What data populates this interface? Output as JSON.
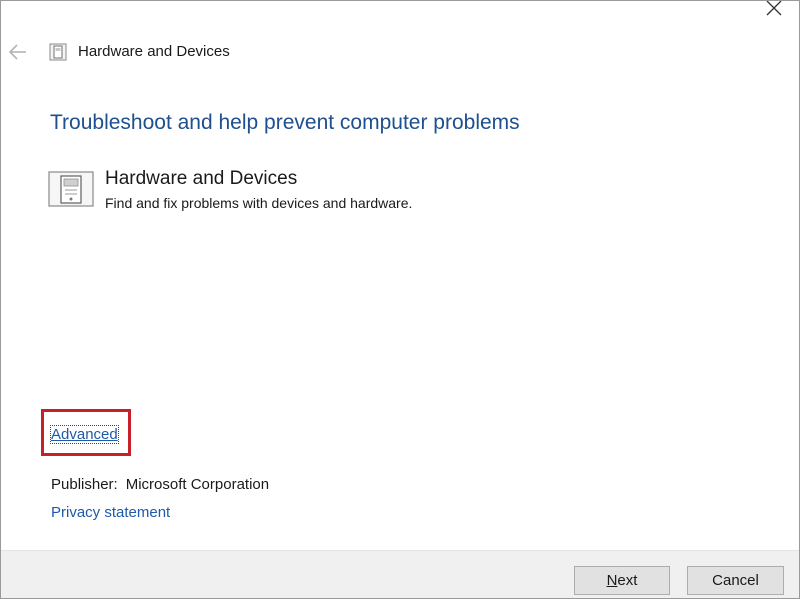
{
  "window": {
    "title": "Hardware and Devices"
  },
  "main": {
    "heading": "Troubleshoot and help prevent computer problems",
    "troubleshooter": {
      "title": "Hardware and Devices",
      "description": "Find and fix problems with devices and hardware."
    },
    "advanced_link": "Advanced",
    "publisher_label": "Publisher:",
    "publisher_value": "Microsoft Corporation",
    "privacy_link": "Privacy statement"
  },
  "footer": {
    "next_accel": "N",
    "next_rest": "ext",
    "cancel_label": "Cancel"
  },
  "icons": {
    "close": "close-icon",
    "back": "back-arrow-icon",
    "title": "troubleshooter-icon",
    "item": "hardware-device-icon"
  },
  "colors": {
    "heading": "#1e4f8f",
    "link": "#1e5aa8",
    "highlight": "#c8202b",
    "footer_bg": "#f0f0f0"
  }
}
